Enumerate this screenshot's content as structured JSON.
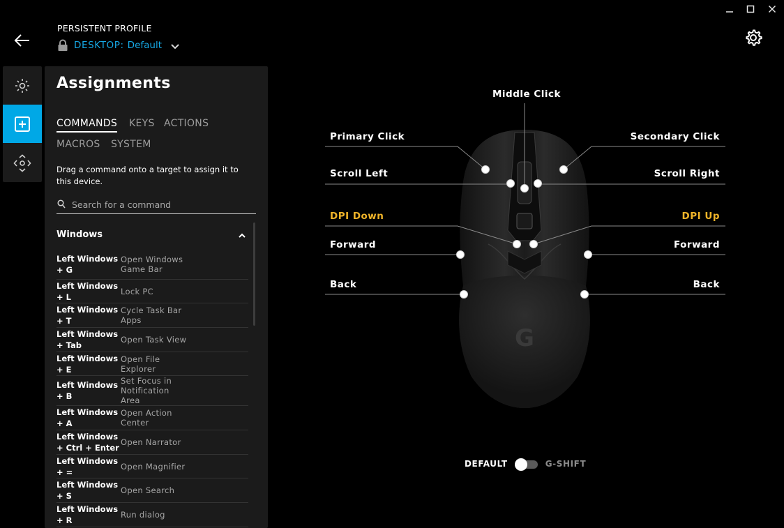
{
  "window": {
    "minimize_icon": "minimize-icon",
    "maximize_icon": "maximize-icon",
    "close_icon": "close-icon"
  },
  "header": {
    "profile_title": "PERSISTENT PROFILE",
    "profile_prefix": "DESKTOP:",
    "profile_name": "Default",
    "accent": "#16a9e6"
  },
  "rail": {
    "items": [
      {
        "icon": "lighting-icon",
        "active": false
      },
      {
        "icon": "assignments-icon",
        "active": true
      },
      {
        "icon": "dpi-sensitivity-icon",
        "active": false
      }
    ],
    "active_color": "#00a8e6"
  },
  "panel": {
    "title": "Assignments",
    "tabs": [
      "COMMANDS",
      "KEYS",
      "ACTIONS",
      "MACROS",
      "SYSTEM"
    ],
    "active_tab": "COMMANDS",
    "hint": "Drag a command onto a target to assign it to this device.",
    "search_placeholder": "Search for a command",
    "section": "Windows",
    "commands": [
      {
        "key": "Left Windows + G",
        "desc": "Open Windows Game Bar"
      },
      {
        "key": "Left Windows + L",
        "desc": "Lock PC"
      },
      {
        "key": "Left Windows + T",
        "desc": "Cycle Task Bar Apps"
      },
      {
        "key": "Left Windows + Tab",
        "desc": "Open Task View"
      },
      {
        "key": "Left Windows + E",
        "desc": "Open File Explorer"
      },
      {
        "key": "Left Windows + B",
        "desc": "Set Focus in Notification Area"
      },
      {
        "key": "Left Windows + A",
        "desc": "Open Action Center"
      },
      {
        "key": "Left Windows + Ctrl + Enter",
        "desc": "Open Narrator"
      },
      {
        "key": "Left Windows + =",
        "desc": "Open Magnifier"
      },
      {
        "key": "Left Windows + S",
        "desc": "Open Search"
      },
      {
        "key": "Left Windows + R",
        "desc": "Run dialog"
      }
    ]
  },
  "mouse": {
    "labels": {
      "middle": "Middle Click",
      "primary": "Primary Click",
      "secondary": "Secondary Click",
      "scroll_left": "Scroll Left",
      "scroll_right": "Scroll Right",
      "dpi_down": "DPI Down",
      "dpi_up": "DPI Up",
      "forward_left": "Forward",
      "forward_right": "Forward",
      "back_left": "Back",
      "back_right": "Back"
    },
    "dpi_color": "#f0b429",
    "logo": "G"
  },
  "toggle": {
    "left": "DEFAULT",
    "right": "G-SHIFT",
    "state": "DEFAULT"
  }
}
